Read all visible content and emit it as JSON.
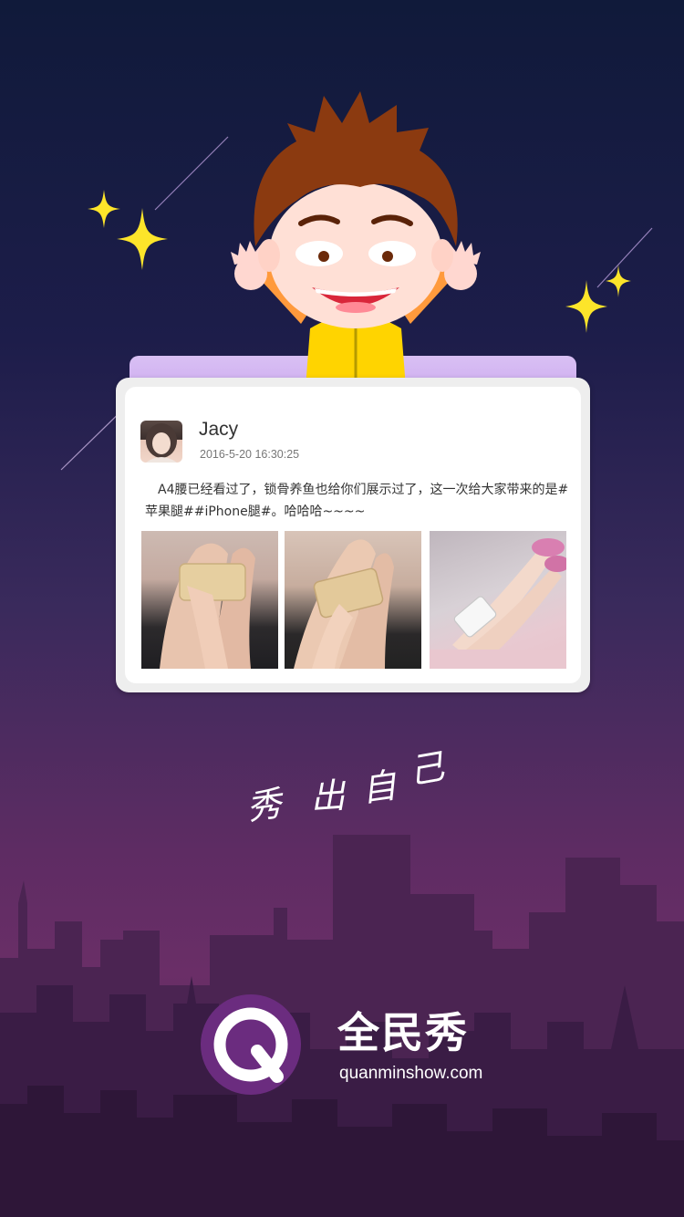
{
  "post": {
    "username": "Jacy",
    "timestamp": "2016-5-20 16:30:25",
    "text": "A4腰已经看过了，锁骨养鱼也给你们展示过了，这一次给大家带来的是#苹果腿##iPhone腿#。哈哈哈~~~~"
  },
  "slogan": {
    "chars": [
      "秀",
      "出",
      "自",
      "己"
    ]
  },
  "brand": {
    "name": "全民秀",
    "url": "quanminshow.com"
  },
  "colors": {
    "accent": "#6b2c7f",
    "sparkle": "#fde52a",
    "card_back": "#c8a3ee"
  },
  "icons": {
    "logo": "q-logo-icon",
    "sparkles": "sparkle-icon"
  }
}
